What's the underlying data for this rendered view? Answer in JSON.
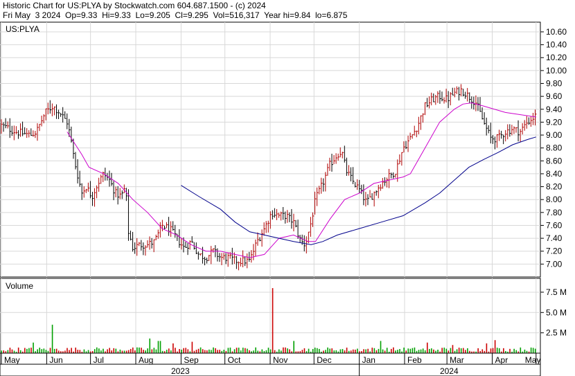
{
  "header": {
    "line1": "Historic Chart for US:PLYA by Stockwatch.com 604.687.1500 - (c) 2024",
    "line2": "Fri May  3 2024  Op=9.33  Hi=9.33  Lo=9.205  Cl=9.295  Vol=516,317  Year hi=9.84  lo=6.875"
  },
  "chart_data": [
    {
      "type": "bar",
      "symbol_label": "US:PLYA",
      "title": "",
      "ylim": [
        6.8,
        10.75
      ],
      "ytick_labels": [
        "7.00",
        "7.20",
        "7.40",
        "7.60",
        "7.80",
        "8.00",
        "8.20",
        "8.40",
        "8.60",
        "8.80",
        "9.00",
        "9.20",
        "9.40",
        "9.60",
        "9.80",
        "10.00",
        "10.20",
        "10.40",
        "10.60"
      ],
      "ytick_values": [
        7.0,
        7.2,
        7.4,
        7.6,
        7.8,
        8.0,
        8.2,
        8.4,
        8.6,
        8.8,
        9.0,
        9.2,
        9.4,
        9.6,
        9.8,
        10.0,
        10.2,
        10.4,
        10.6
      ],
      "x_month_labels": [
        "May",
        "Jun",
        "Jul",
        "Aug",
        "Sep",
        "Oct",
        "Nov",
        "Dec",
        "Jan",
        "Feb",
        "Mar",
        "Apr",
        "May"
      ],
      "x_month_start_days": [
        0,
        31,
        61,
        92,
        123,
        153,
        184,
        214,
        245,
        276,
        305,
        336,
        366
      ],
      "x_year_labels": [
        "2023",
        "2024"
      ],
      "x_year_start_days": [
        0,
        245
      ],
      "x_range_days": [
        0,
        368
      ],
      "grid": true,
      "close_anchors": {
        "day": [
          0,
          10,
          20,
          24,
          30,
          35,
          40,
          45,
          47,
          50,
          55,
          58,
          62,
          66,
          70,
          74,
          78,
          82,
          85,
          87,
          90,
          95,
          100,
          105,
          110,
          115,
          120,
          125,
          130,
          135,
          140,
          145,
          150,
          155,
          160,
          165,
          170,
          175,
          180,
          185,
          190,
          195,
          200,
          205,
          208,
          212,
          215,
          220,
          225,
          230,
          233,
          236,
          240,
          245,
          250,
          255,
          260,
          265,
          270,
          275,
          280,
          285,
          290,
          295,
          300,
          305,
          310,
          315,
          320,
          325,
          330,
          335,
          340,
          345,
          350,
          355,
          360,
          366
        ],
        "close": [
          9.15,
          9.05,
          9.0,
          9.05,
          9.35,
          9.45,
          9.35,
          9.2,
          9.0,
          8.6,
          8.1,
          8.2,
          8.05,
          8.25,
          8.4,
          8.3,
          8.1,
          8.05,
          8.2,
          7.5,
          7.25,
          7.3,
          7.3,
          7.35,
          7.6,
          7.55,
          7.4,
          7.25,
          7.35,
          7.15,
          7.1,
          7.2,
          7.1,
          7.1,
          7.05,
          7.05,
          7.05,
          7.35,
          7.55,
          7.8,
          7.75,
          7.75,
          7.65,
          7.35,
          7.3,
          7.65,
          8.0,
          8.25,
          8.55,
          8.7,
          8.75,
          8.45,
          8.3,
          8.15,
          7.95,
          8.1,
          8.25,
          8.35,
          8.45,
          8.8,
          8.95,
          9.15,
          9.45,
          9.55,
          9.6,
          9.55,
          9.65,
          9.7,
          9.6,
          9.5,
          9.2,
          8.95,
          8.95,
          9.05,
          9.1,
          9.05,
          9.2,
          9.3
        ]
      },
      "close_noise_sd": 0.06,
      "bar_range_typical": 0.12,
      "series": [
        {
          "name": "",
          "color": "#cc00cc",
          "points": [
            [
              45,
              9.05
            ],
            [
              55,
              8.7
            ],
            [
              60,
              8.5
            ],
            [
              70,
              8.4
            ],
            [
              80,
              8.25
            ],
            [
              90,
              8.0
            ],
            [
              100,
              7.8
            ],
            [
              110,
              7.55
            ],
            [
              120,
              7.45
            ],
            [
              130,
              7.3
            ],
            [
              140,
              7.2
            ],
            [
              150,
              7.2
            ],
            [
              160,
              7.15
            ],
            [
              170,
              7.1
            ],
            [
              180,
              7.15
            ],
            [
              190,
              7.4
            ],
            [
              200,
              7.45
            ],
            [
              210,
              7.35
            ],
            [
              215,
              7.35
            ],
            [
              225,
              7.7
            ],
            [
              235,
              8.0
            ],
            [
              245,
              8.1
            ],
            [
              255,
              8.25
            ],
            [
              265,
              8.3
            ],
            [
              275,
              8.35
            ],
            [
              280,
              8.4
            ],
            [
              290,
              8.8
            ],
            [
              300,
              9.2
            ],
            [
              310,
              9.4
            ],
            [
              316,
              9.48
            ],
            [
              322,
              9.5
            ],
            [
              330,
              9.45
            ],
            [
              345,
              9.35
            ],
            [
              366,
              9.28
            ]
          ]
        },
        {
          "name": "",
          "color": "#00008b",
          "points": [
            [
              123,
              8.22
            ],
            [
              135,
              8.05
            ],
            [
              150,
              7.85
            ],
            [
              160,
              7.65
            ],
            [
              170,
              7.5
            ],
            [
              180,
              7.45
            ],
            [
              190,
              7.4
            ],
            [
              200,
              7.35
            ],
            [
              212,
              7.3
            ],
            [
              220,
              7.35
            ],
            [
              230,
              7.45
            ],
            [
              245,
              7.55
            ],
            [
              260,
              7.65
            ],
            [
              275,
              7.75
            ],
            [
              290,
              7.95
            ],
            [
              300,
              8.1
            ],
            [
              310,
              8.3
            ],
            [
              320,
              8.5
            ],
            [
              330,
              8.62
            ],
            [
              340,
              8.73
            ],
            [
              350,
              8.85
            ],
            [
              360,
              8.93
            ],
            [
              366,
              8.97
            ]
          ]
        }
      ],
      "bar_color_up": "#b00000",
      "bar_color_down": "#000000"
    },
    {
      "type": "bar",
      "label": "Volume",
      "ylim": [
        0,
        9.2
      ],
      "ytick_labels": [
        "2.5 M",
        "5.0 M",
        "7.5 M"
      ],
      "ytick_values": [
        2.5,
        5.0,
        7.5
      ],
      "unit": "M",
      "typical_volume": 0.5,
      "spikes": [
        {
          "day": 35,
          "value": 3.5
        },
        {
          "day": 22,
          "value": 1.3
        },
        {
          "day": 102,
          "value": 1.8
        },
        {
          "day": 108,
          "value": 1.5
        },
        {
          "day": 118,
          "value": 1.2
        },
        {
          "day": 131,
          "value": 1.4
        },
        {
          "day": 186,
          "value": 8.0
        },
        {
          "day": 185,
          "value": 3.8
        },
        {
          "day": 200,
          "value": 1.5
        },
        {
          "day": 260,
          "value": 1.5
        },
        {
          "day": 291,
          "value": 1.3
        },
        {
          "day": 309,
          "value": 1.0
        },
        {
          "day": 332,
          "value": 1.2
        },
        {
          "day": 338,
          "value": 1.6
        }
      ],
      "color_up": "#00a000",
      "color_down": "#cc0000"
    }
  ]
}
